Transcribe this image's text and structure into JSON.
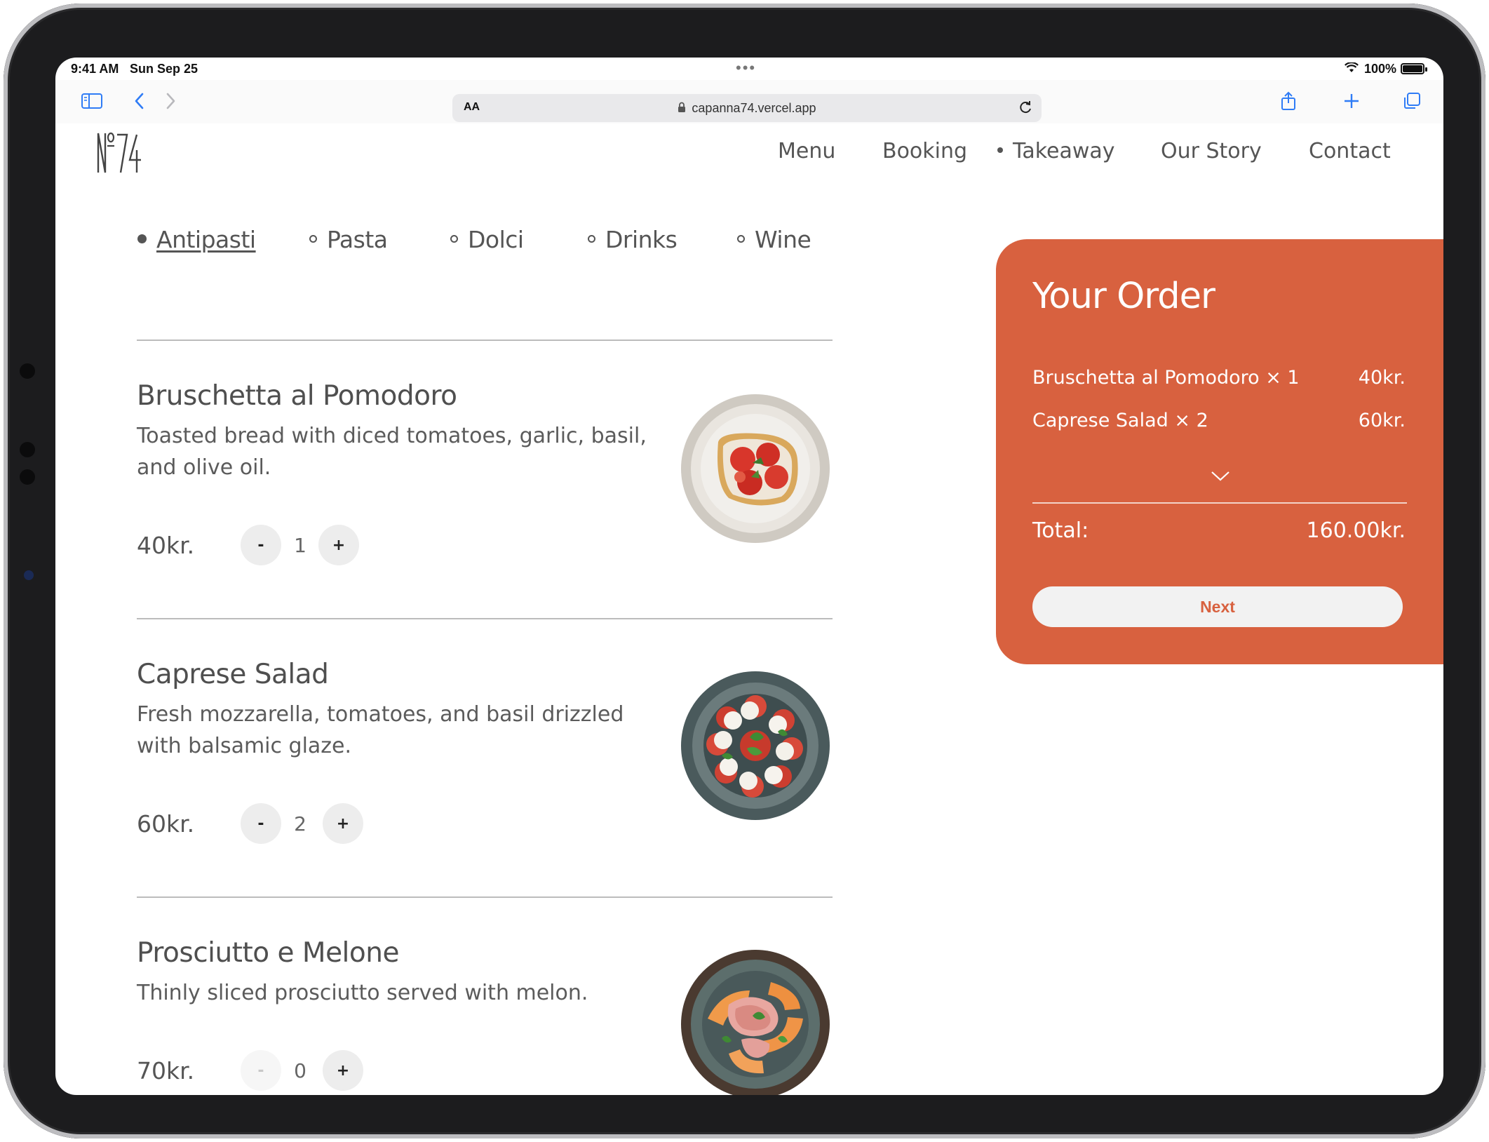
{
  "status_bar": {
    "time": "9:41 AM",
    "date": "Sun Sep 25",
    "battery": "100%",
    "battery_level": 1.0
  },
  "browser": {
    "aa_label": "AA",
    "url": "capanna74.vercel.app",
    "icons": {
      "sidebar": "sidebar-icon",
      "back": "chevron-left-icon",
      "forward": "chevron-right-icon",
      "share": "share-icon",
      "new_tab": "plus-icon",
      "tabs": "tabs-icon",
      "reload": "reload-icon",
      "lock": "lock-icon"
    }
  },
  "site": {
    "logo": "№74",
    "nav": [
      {
        "label": "Menu",
        "active": false
      },
      {
        "label": "Booking",
        "active": false
      },
      {
        "label": "Takeaway",
        "active": true
      },
      {
        "label": "Our Story",
        "active": false
      },
      {
        "label": "Contact",
        "active": false
      }
    ]
  },
  "categories": [
    {
      "label": "Antipasti",
      "active": true
    },
    {
      "label": "Pasta",
      "active": false
    },
    {
      "label": "Dolci",
      "active": false
    },
    {
      "label": "Drinks",
      "active": false
    },
    {
      "label": "Wine",
      "active": false
    }
  ],
  "items": [
    {
      "name": "Bruschetta al Pomodoro",
      "description": "Toasted bread with diced tomatoes, garlic, basil, and olive oil.",
      "price": "40kr.",
      "quantity": "1",
      "minus": "-",
      "plus": "+"
    },
    {
      "name": "Caprese Salad",
      "description": "Fresh mozzarella, tomatoes, and basil drizzled with balsamic glaze.",
      "price": "60kr.",
      "quantity": "2",
      "minus": "-",
      "plus": "+"
    },
    {
      "name": "Prosciutto e Melone",
      "description": "Thinly sliced prosciutto served with melon.",
      "price": "70kr.",
      "quantity": "0",
      "minus": "-",
      "plus": "+"
    }
  ],
  "order": {
    "title": "Your Order",
    "lines": [
      {
        "label": "Bruschetta al Pomodoro × 1",
        "amount": "40kr."
      },
      {
        "label": "Caprese Salad × 2",
        "amount": "60kr."
      }
    ],
    "total_label": "Total:",
    "total_amount": "160.00kr.",
    "next_label": "Next",
    "expand_icon": "chevron-down-icon"
  },
  "colors": {
    "accent": "#d8613f",
    "text": "#555555",
    "button_bg": "#ededed"
  }
}
